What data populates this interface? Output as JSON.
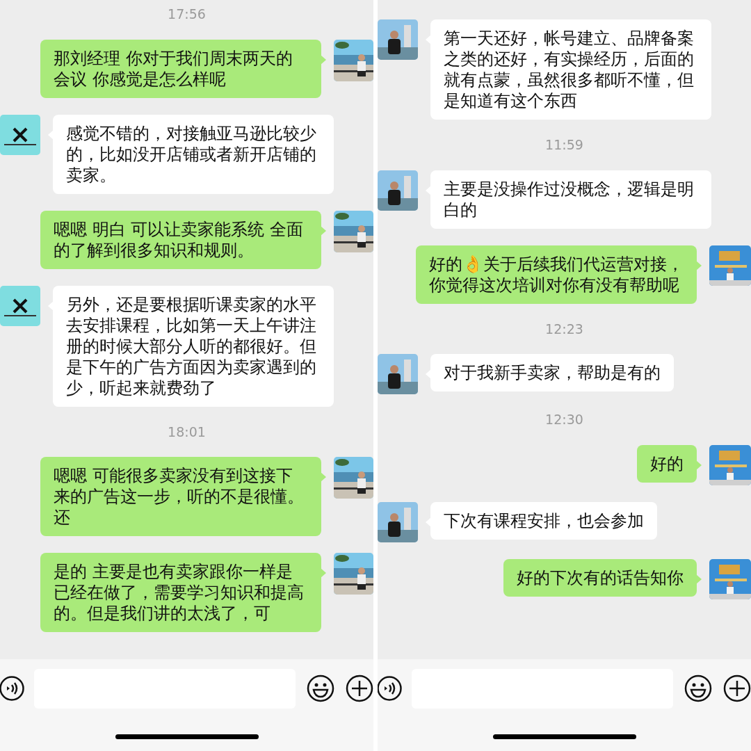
{
  "panels": [
    {
      "items": [
        {
          "kind": "time",
          "text": "17:56"
        },
        {
          "kind": "message",
          "sent": true,
          "text": "那刘经理 你对于我们周末两天的会议 你感觉是怎么样呢"
        },
        {
          "kind": "message",
          "sent": false,
          "text": "感觉不错的，对接触亚马逊比较少的，比如没开店铺或者新开店铺的卖家。"
        },
        {
          "kind": "message",
          "sent": true,
          "text": "嗯嗯 明白 可以让卖家能系统 全面的了解到很多知识和规则。"
        },
        {
          "kind": "message",
          "sent": false,
          "text": "另外，还是要根据听课卖家的水平去安排课程，比如第一天上午讲注册的时候大部分人听的都很好。但是下午的广告方面因为卖家遇到的少，听起来就费劲了"
        },
        {
          "kind": "time",
          "text": "18:01"
        },
        {
          "kind": "message",
          "sent": true,
          "text": "嗯嗯 可能很多卖家没有到这接下来的广告这一步，听的不是很懂。还"
        },
        {
          "kind": "message",
          "sent": true,
          "text": "是的 主要是也有卖家跟你一样是已经在做了，需要学习知识和提高的。但是我们讲的太浅了，可"
        }
      ]
    },
    {
      "items": [
        {
          "kind": "message",
          "sent": false,
          "text": "第一天还好，帐号建立、品牌备案之类的还好，有实操经历，后面的就有点蒙，虽然很多都听不懂，但是知道有这个东西"
        },
        {
          "kind": "time",
          "text": "11:59"
        },
        {
          "kind": "message",
          "sent": false,
          "text": "主要是没操作过没概念，逻辑是明白的"
        },
        {
          "kind": "message",
          "sent": true,
          "text": "好的👌关于后续我们代运营对接，你觉得这次培训对你有没有帮助呢"
        },
        {
          "kind": "time",
          "text": "12:23"
        },
        {
          "kind": "message",
          "sent": false,
          "text": "对于我新手卖家，帮助是有的"
        },
        {
          "kind": "time",
          "text": "12:30"
        },
        {
          "kind": "message",
          "sent": true,
          "text": "好的"
        },
        {
          "kind": "message",
          "sent": false,
          "text": "下次有课程安排，也会参加"
        },
        {
          "kind": "message",
          "sent": true,
          "text": "好的下次有的话告知你"
        }
      ]
    }
  ]
}
